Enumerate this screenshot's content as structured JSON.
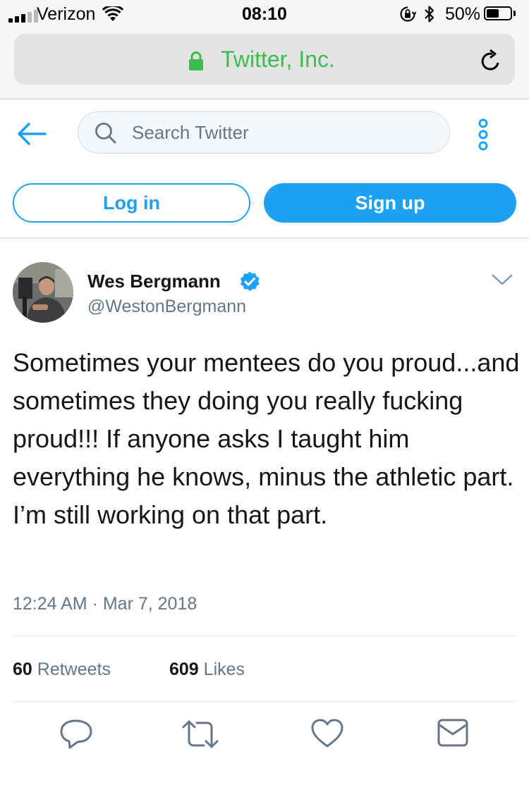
{
  "status_bar": {
    "carrier": "Verizon",
    "time": "08:10",
    "battery_percent": "50%",
    "battery_level": 0.5
  },
  "browser": {
    "url_label": "Twitter, Inc.",
    "accent_color": "#3fbc4f"
  },
  "header": {
    "search_placeholder": "Search Twitter",
    "login_label": "Log in",
    "signup_label": "Sign up",
    "brand_color": "#1da1f2"
  },
  "tweet": {
    "display_name": "Wes Bergmann",
    "handle": "@WestonBergmann",
    "verified": true,
    "text": "Sometimes your mentees do you proud...and sometimes they doing you really fucking proud!!! If anyone asks I taught him everything he knows, minus the athletic part. I’m still working on that part.",
    "timestamp": "12:24 AM · Mar 7, 2018",
    "retweets_count": "60",
    "retweets_label": "Retweets",
    "likes_count": "609",
    "likes_label": "Likes"
  },
  "icons": [
    "back-arrow-icon",
    "search-icon",
    "more-icon",
    "verified-icon",
    "chevron-down-icon",
    "reply-icon",
    "retweet-icon",
    "like-icon",
    "message-icon",
    "lock-icon",
    "reload-icon"
  ]
}
